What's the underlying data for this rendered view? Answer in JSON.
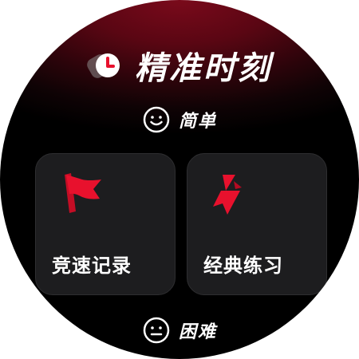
{
  "app": {
    "title": "精准时刻",
    "logo_icon": "clock-logo-icon"
  },
  "difficulty": {
    "easy": {
      "label": "简单",
      "icon": "smile-face-icon"
    },
    "hard": {
      "label": "困难",
      "icon": "neutral-face-icon"
    }
  },
  "modes": [
    {
      "label": "竞速记录",
      "icon": "flag-icon"
    },
    {
      "label": "经典练习",
      "icon": "lightning-bolt-icon"
    }
  ],
  "colors": {
    "accent": "#e8112d",
    "card_background": "#1d1d1f",
    "background_top": "#7a0a1b",
    "text": "#ffffff"
  }
}
